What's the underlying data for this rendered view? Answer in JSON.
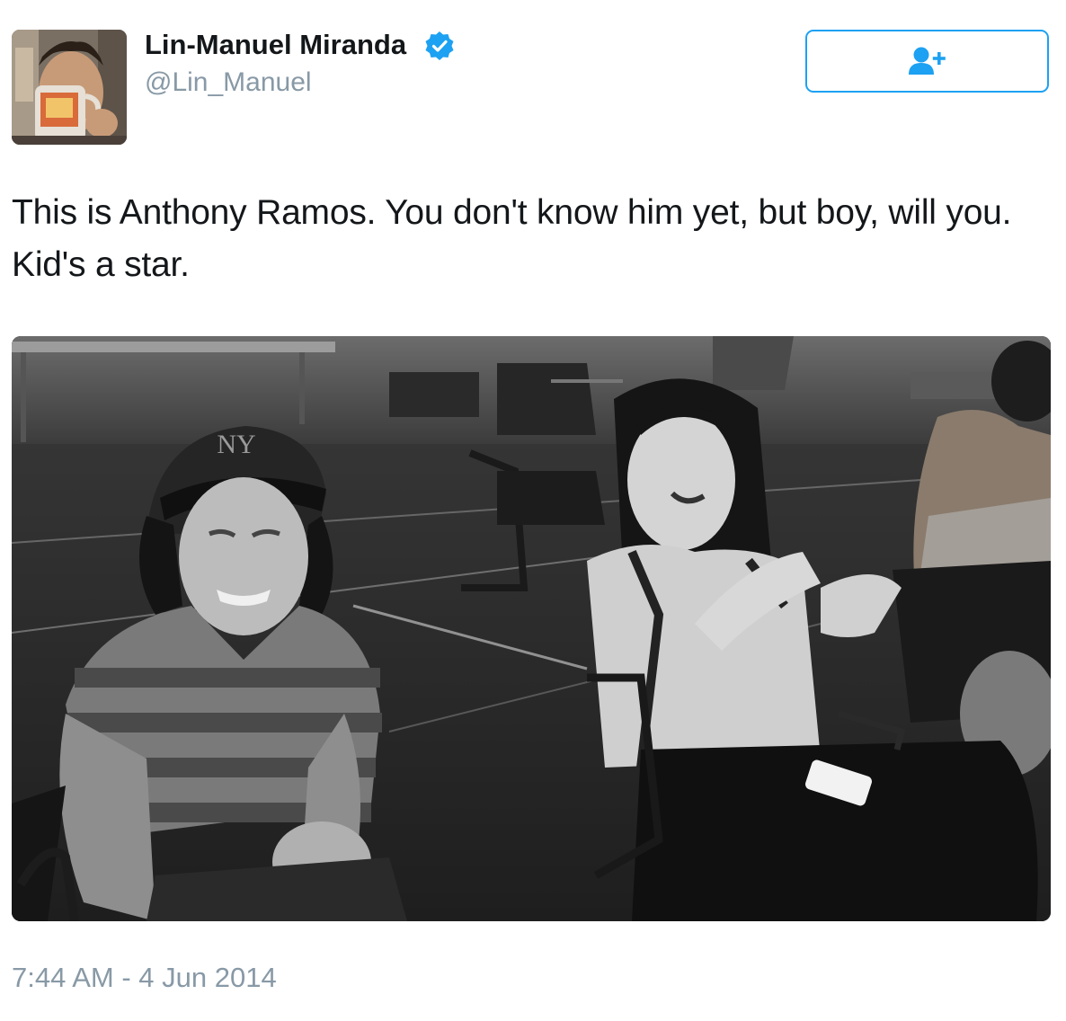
{
  "author": {
    "display_name": "Lin-Manuel Miranda",
    "handle": "@Lin_Manuel",
    "verified": true,
    "avatar_icon": "profile-photo"
  },
  "follow_button": {
    "icon": "add-user-icon",
    "color": "#1da1f2"
  },
  "tweet": {
    "text": "This is Anthony Ramos. You don't know him yet, but boy, will you. Kid's a star.",
    "timestamp": "7:44 AM - 4 Jun 2014"
  },
  "media": {
    "type": "photo",
    "cap_logo": "NY"
  },
  "colors": {
    "text": "#14171a",
    "secondary": "#8899a6",
    "accent": "#1da1f2"
  }
}
